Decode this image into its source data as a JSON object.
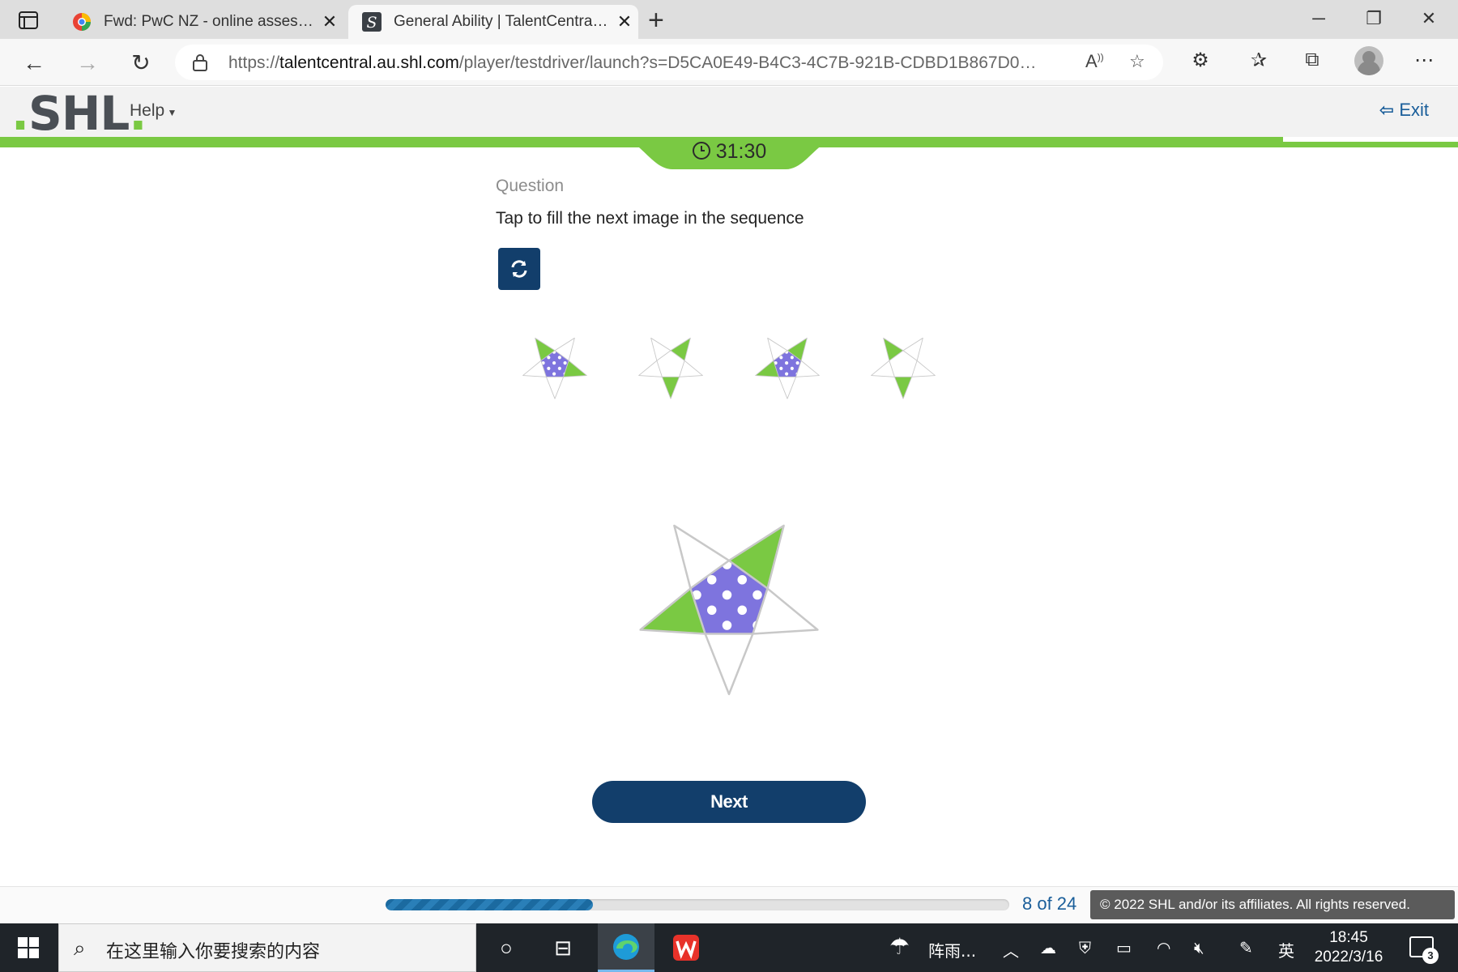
{
  "browser": {
    "tabs": [
      {
        "title": "Fwd: PwC NZ - online assessmen",
        "active": false,
        "icon": "mail-app-icon"
      },
      {
        "title": "General Ability | TalentCentral-Ca",
        "active": true,
        "icon": "shl-favicon"
      }
    ],
    "url_prefix": "https://",
    "url_host": "talentcentral.au.shl.com",
    "url_path": "/player/testdriver/launch?s=D5CA0E49-B4C3-4C7B-921B-CDBD1B867D0F&fro..."
  },
  "app": {
    "logo_text": "SHL",
    "help_label": "Help",
    "exit_label": "Exit",
    "timer": "31:30",
    "accent_color": "#7ac943",
    "primary_color": "#123e6b"
  },
  "question": {
    "label": "Question",
    "prompt": "Tap to fill the next image in the sequence",
    "sequence": [
      {
        "center": "purple-dotted",
        "green_points": [
          "top-left",
          "right"
        ]
      },
      {
        "center": "empty",
        "green_points": [
          "top-right",
          "bottom"
        ]
      },
      {
        "center": "purple-dotted",
        "green_points": [
          "top-right",
          "left"
        ]
      },
      {
        "center": "empty",
        "green_points": [
          "top-left",
          "bottom"
        ]
      }
    ],
    "answer_option": {
      "center": "purple-dotted",
      "green_points": [
        "top-right",
        "left"
      ]
    },
    "next_label": "Next"
  },
  "footer": {
    "progress_text": "8 of 24",
    "progress_fraction": 0.333,
    "copyright": "© 2022 SHL and/or its affiliates. All rights reserved."
  },
  "taskbar": {
    "search_placeholder": "在这里输入你要搜索的内容",
    "weather": "阵雨...",
    "ime": "英",
    "time": "18:45",
    "date": "2022/3/16",
    "notification_count": "3"
  }
}
